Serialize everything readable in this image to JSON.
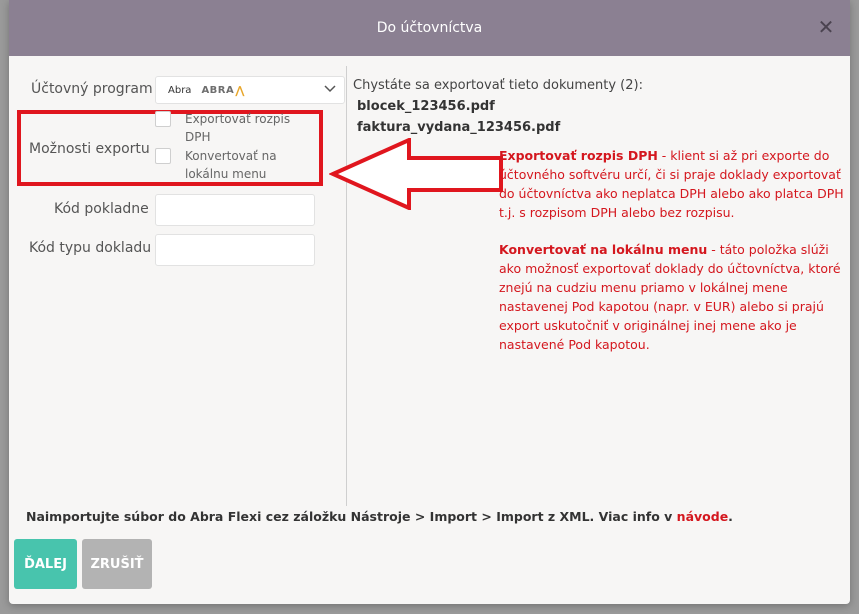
{
  "dialog": {
    "title": "Do účtovníctva",
    "close_icon": "close-icon"
  },
  "form": {
    "program_label": "Účtovný program",
    "program_value_small": "Abra",
    "program_value_logo": "ABRA",
    "export_options_label": "Možnosti exportu",
    "option1_label": "Exportovať rozpis DPH",
    "option2_label": "Konvertovať na lokálnu menu",
    "cash_register_label": "Kód pokladne",
    "doc_type_label": "Kód typu dokladu"
  },
  "right": {
    "intro": "Chystáte sa exportovať tieto dokumenty (2):",
    "files": [
      "blocek_123456.pdf",
      "faktura_vydana_123456.pdf"
    ]
  },
  "annotations": {
    "a1_bold": "Exportovať rozpis DPH",
    "a1_text": " - klient si až pri exporte do účtovného softvéru určí, či si praje doklady exportovať do účtovníctva ako neplatca DPH alebo ako platca DPH t.j. s rozpisom DPH alebo bez rozpisu.",
    "a2_bold": "Konvertovať na lokálnu menu",
    "a2_text": " - táto položka slúži ako možnosť exportovať doklady do účtovníctva, ktoré znejú na cudziu menu priamo v lokálnej mene nastavenej Pod kapotou (napr. v EUR) alebo si prajú export uskutočniť v originálnej inej mene ako je nastavené Pod kapotou."
  },
  "footer": {
    "note": "Naimportujte súbor do Abra Flexi cez záložku Nástroje > Import > Import z XML. Viac info v ",
    "link": "návode",
    "note_end": ".",
    "next_label": "ĎALEJ",
    "cancel_label": "ZRUŠIŤ"
  },
  "colors": {
    "title_bar": "#8b8092",
    "highlight_red": "#e0161e",
    "next_button": "#48c4ad",
    "cancel_button": "#b3b3b3"
  }
}
